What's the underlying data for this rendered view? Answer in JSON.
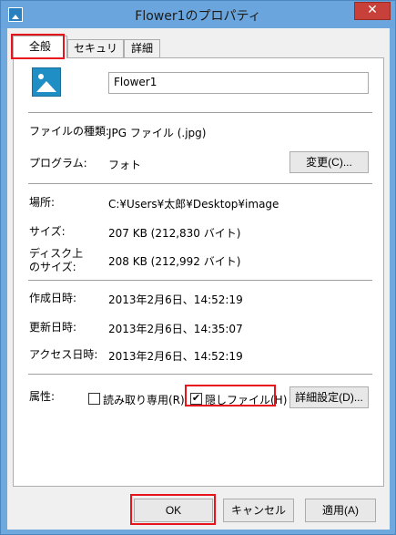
{
  "window": {
    "title": "Flower1のプロパティ",
    "close_label": "✕"
  },
  "tabs": [
    {
      "label": "全般"
    },
    {
      "label": "セキュリティ"
    },
    {
      "label": "詳細"
    }
  ],
  "general": {
    "file_name": "Flower1",
    "file_type_label": "ファイルの種類:",
    "file_type_value": "JPG ファイル (.jpg)",
    "program_label": "プログラム:",
    "program_value": "フォト",
    "change_button": "変更(C)...",
    "location_label": "場所:",
    "location_value": "C:¥Users¥太郎¥Desktop¥image",
    "size_label": "サイズ:",
    "size_value": "207 KB (212,830 バイト)",
    "disk_size_label_1": "ディスク上",
    "disk_size_label_2": "のサイズ:",
    "disk_size_value": "208 KB (212,992 バイト)",
    "created_label": "作成日時:",
    "created_value": "2013年2月6日、14:52:19",
    "modified_label": "更新日時:",
    "modified_value": "2013年2月6日、14:35:07",
    "accessed_label": "アクセス日時:",
    "accessed_value": "2013年2月6日、14:52:19",
    "attributes_label": "属性:",
    "readonly_label": "読み取り専用(R)",
    "readonly_checked": false,
    "hidden_label": "隠しファイル(H)",
    "hidden_checked": true,
    "advanced_button": "詳細設定(D)..."
  },
  "footer": {
    "ok": "OK",
    "cancel": "キャンセル",
    "apply": "適用(A)"
  },
  "icons": {
    "window_icon": "image-file-icon",
    "file_icon": "image-file-icon"
  },
  "colors": {
    "highlight": "#e8141b",
    "titlebar": "#6aa6dd",
    "close": "#c8403a"
  }
}
